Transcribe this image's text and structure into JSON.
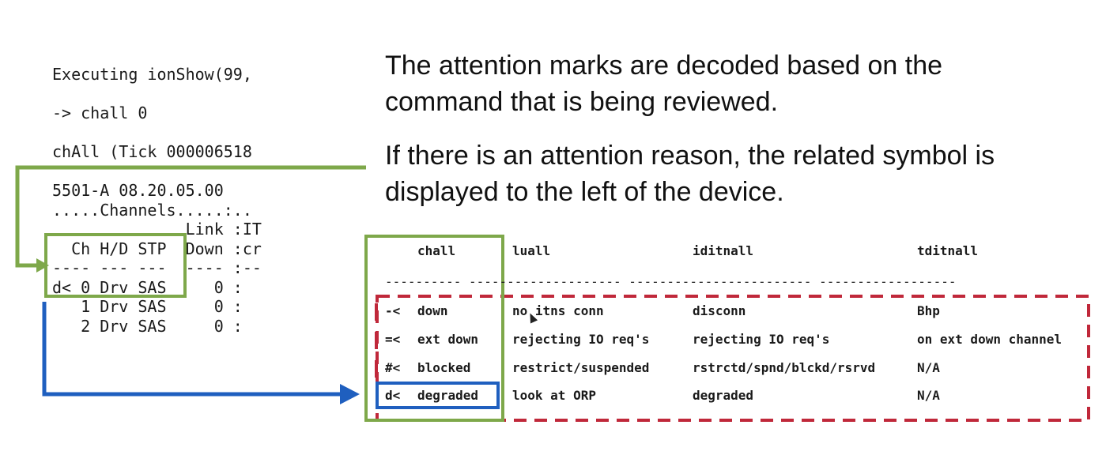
{
  "terminal": {
    "line1": "Executing ionShow(99,",
    "line2": "-> chall 0",
    "line3": "chAll (Tick 000006518",
    "line4": "5501-A 08.20.05.00",
    "line5": ".....Channels.....:..",
    "line6": "              Link :IT",
    "line7": "  Ch H/D STP  Down :cr",
    "line8": "---- --- ---  ---- :--",
    "line9": "d< 0 Drv SAS     0 :",
    "line10": "   1 Drv SAS     0 :",
    "line11": "   2 Drv SAS     0 :"
  },
  "text": {
    "para1_line1": "The attention marks are decoded based on the",
    "para1_line2": "command that is being reviewed.",
    "para2_line1": "If there is an attention reason, the related symbol is",
    "para2_line2": "displayed to the left of the device."
  },
  "table": {
    "headers": [
      "chall",
      "luall",
      "iditnall",
      "tditnall"
    ],
    "separator": "---------- -------------------- ------------------------ ------------------",
    "rows": [
      [
        "-<",
        "down",
        "no itns conn",
        "disconn",
        "Bhp"
      ],
      [
        "=<",
        "ext down",
        "rejecting IO req's",
        "rejecting IO req's",
        "on ext down channel"
      ],
      [
        "#<",
        "blocked",
        "restrict/suspended",
        "rstrctd/spnd/blckd/rsrvd",
        "N/A"
      ],
      [
        "d<",
        "degraded",
        "look at ORP",
        "degraded",
        "N/A"
      ]
    ]
  },
  "colors": {
    "green": "#7ea84a",
    "blue": "#1f5fbf",
    "red": "#c0283a"
  }
}
